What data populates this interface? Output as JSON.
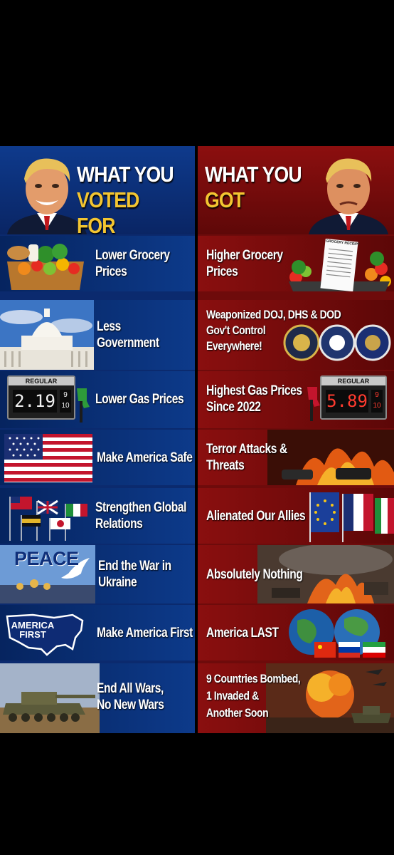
{
  "header": {
    "left_line1": "WHAT YOU",
    "left_line2": "VOTED FOR",
    "right_line1": "WHAT YOU",
    "right_line2": "GOT"
  },
  "rows": [
    {
      "voted": [
        "Lower Grocery",
        "Prices"
      ],
      "got": [
        "Higher Grocery",
        "Prices"
      ],
      "receipt": "GROCERY RECEIPT"
    },
    {
      "voted": [
        "Less",
        "Government"
      ],
      "got": [
        "Weaponized DOJ, DHS & DOD",
        "Gov't Control",
        "Everywhere!"
      ]
    },
    {
      "voted": [
        "Lower Gas Prices"
      ],
      "got": [
        "Highest Gas Prices",
        "Since 2022"
      ],
      "gas_left": {
        "label": "REGULAR",
        "price": "2.19",
        "frac_top": "9",
        "frac_bottom": "10"
      },
      "gas_right": {
        "label": "REGULAR",
        "price": "5.89",
        "frac_top": "9",
        "frac_bottom": "10"
      }
    },
    {
      "voted": [
        "Make America Safe"
      ],
      "got": [
        "Terror Attacks &",
        "Threats"
      ]
    },
    {
      "voted": [
        "Strengthen Global",
        "Relations"
      ],
      "got": [
        "Alienated Our Allies"
      ]
    },
    {
      "voted": [
        "End the War in",
        "Ukraine"
      ],
      "got": [
        "Absolutely Nothing"
      ],
      "peace": "PEACE"
    },
    {
      "voted": [
        "Make America First"
      ],
      "got": [
        "America LAST"
      ],
      "map_line1": "AMERICA",
      "map_line2": "FIRST"
    },
    {
      "voted": [
        "End All Wars,",
        "No New Wars"
      ],
      "got": [
        "9 Countries Bombed,",
        "1 Invaded &",
        "Another Soon"
      ]
    }
  ]
}
